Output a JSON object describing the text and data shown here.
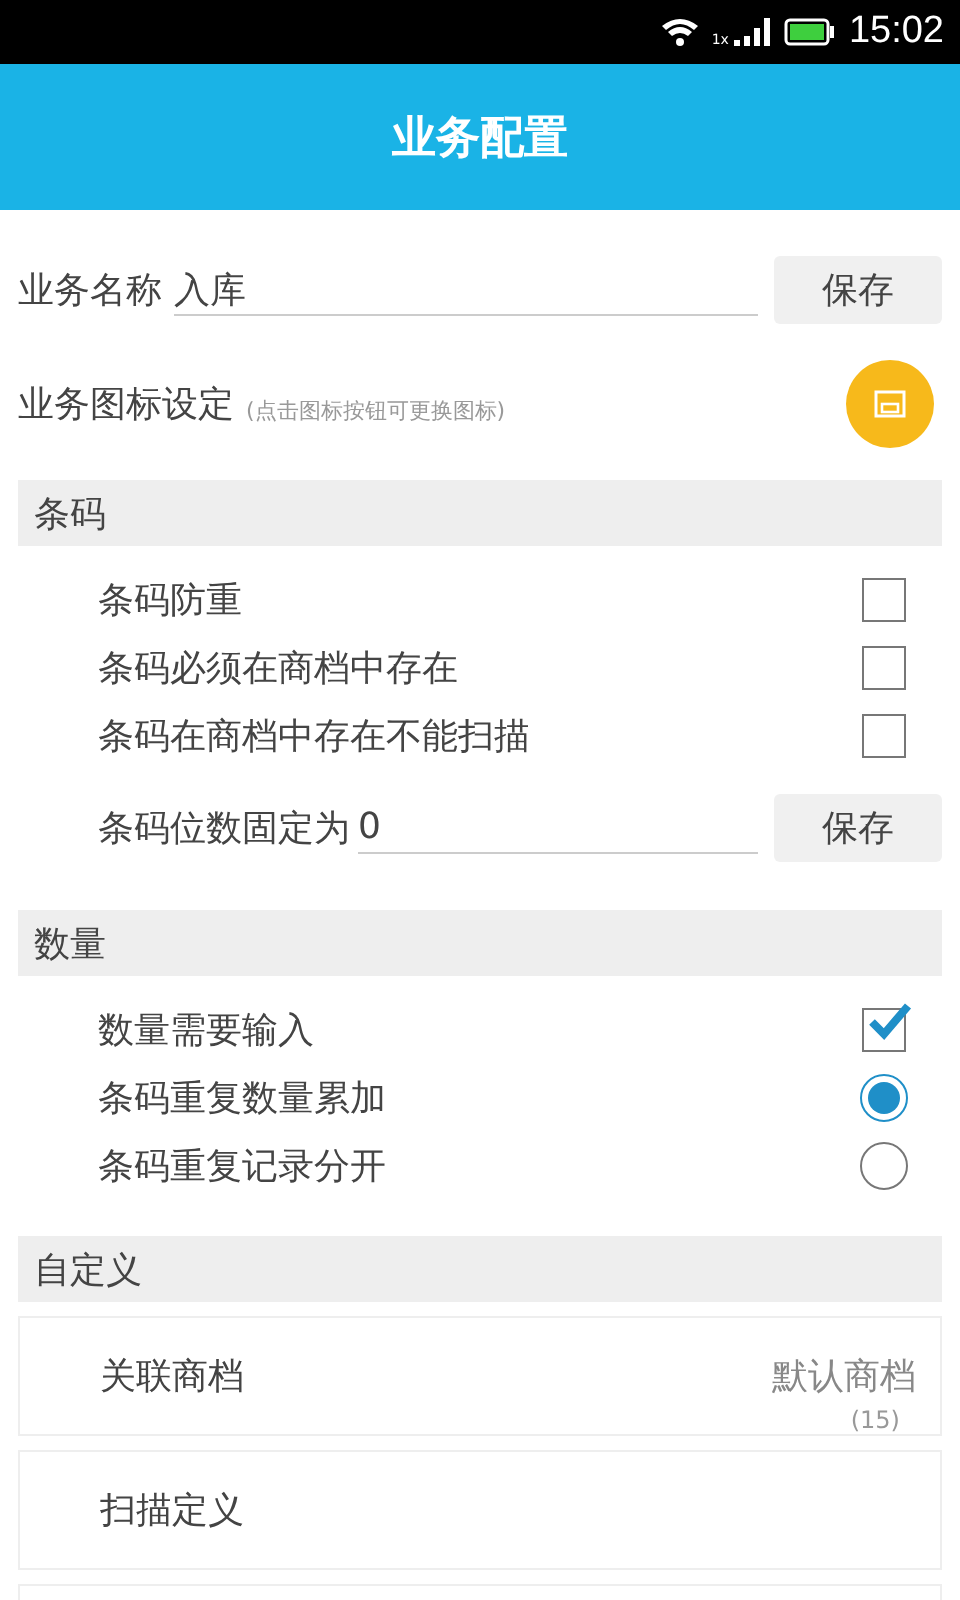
{
  "status_bar": {
    "network": "1x",
    "time": "15:02"
  },
  "title": "业务配置",
  "name_row": {
    "label": "业务名称",
    "value": "入库",
    "button": "保存"
  },
  "icon_row": {
    "label": "业务图标设定",
    "hint": "(点击图标按钮可更换图标)"
  },
  "sections": [
    {
      "title": "条码",
      "items": [
        {
          "kind": "checkbox",
          "label": "条码防重",
          "checked": false
        },
        {
          "kind": "checkbox",
          "label": "条码必须在商档中存在",
          "checked": false
        },
        {
          "kind": "checkbox",
          "label": "条码在商档中存在不能扫描",
          "checked": false
        },
        {
          "kind": "field",
          "label": "条码位数固定为",
          "value": "0",
          "button": "保存"
        }
      ]
    },
    {
      "title": "数量",
      "items": [
        {
          "kind": "checkbox",
          "label": "数量需要输入",
          "checked": true
        },
        {
          "kind": "radio",
          "label": "条码重复数量累加",
          "selected": true
        },
        {
          "kind": "radio",
          "label": "条码重复记录分开",
          "selected": false
        }
      ]
    }
  ],
  "custom": {
    "title": "自定义",
    "items": [
      {
        "label": "关联商档",
        "value": "默认商档",
        "count": "(15)"
      },
      {
        "label": "扫描定义"
      }
    ]
  }
}
